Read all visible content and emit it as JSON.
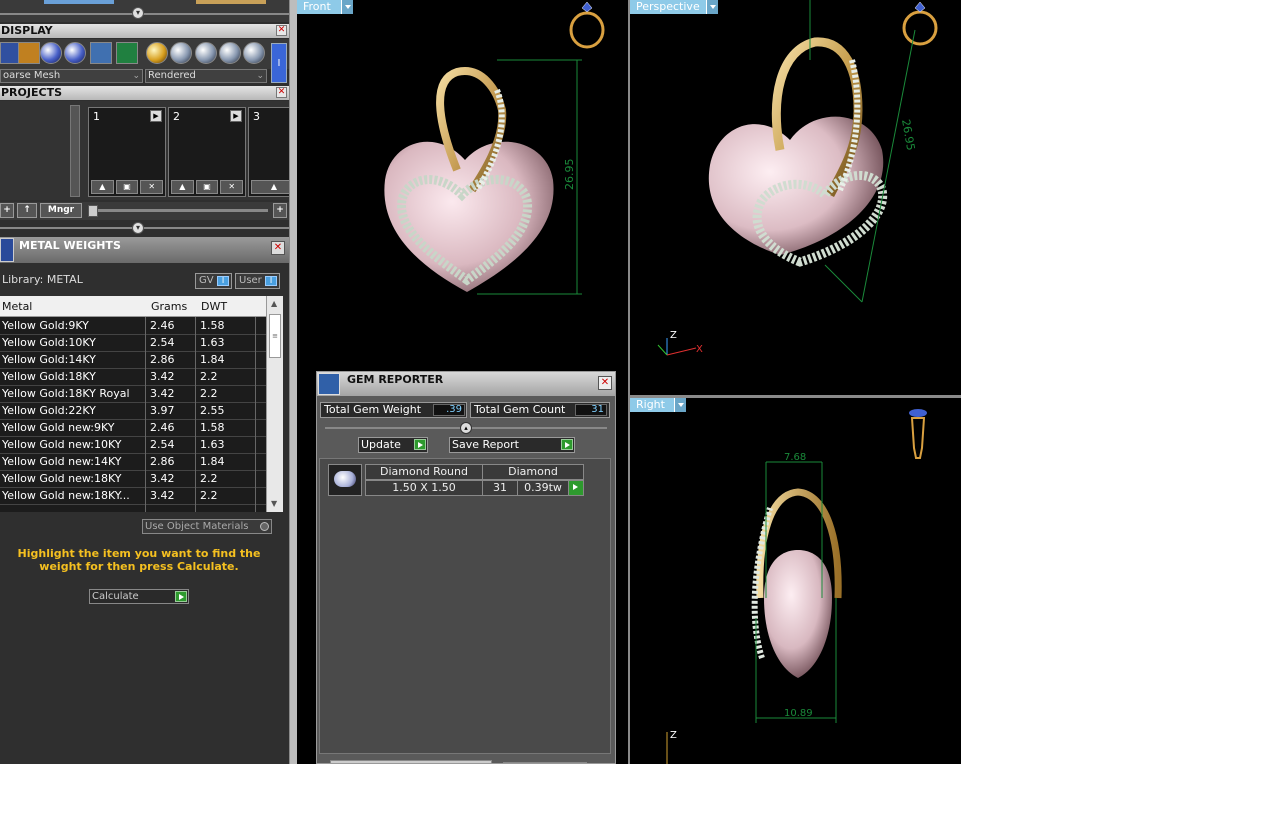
{
  "display_panel": {
    "title": "DISPLAY",
    "mesh_mode": "oarse Mesh",
    "render_mode": "Rendered",
    "mode_button": "I",
    "icons": [
      "grid-icon",
      "move-icon",
      "sphere-icon",
      "sphere-shaded-icon",
      "globe-icon",
      "layout-icon",
      "gold-material-icon",
      "metal-sphere-icon",
      "steel-sphere-icon",
      "wire-sphere-icon",
      "wire-sphere-2-icon"
    ]
  },
  "projects_panel": {
    "title": "PROJECTS",
    "slots": [
      {
        "number": "1"
      },
      {
        "number": "2"
      },
      {
        "number": "3"
      }
    ],
    "mngr_label": "Mngr",
    "add_label": "+",
    "up_label": "↑",
    "plus_right": "+"
  },
  "metal_weights": {
    "title": "METAL WEIGHTS",
    "library_label": "Library: METAL",
    "gv_label": "GV",
    "user_label": "User",
    "toggle_mark": "I",
    "columns": [
      "Metal",
      "Grams",
      "DWT"
    ],
    "rows": [
      {
        "metal": "Yellow Gold:9KY",
        "grams": "2.46",
        "dwt": "1.58"
      },
      {
        "metal": "Yellow Gold:10KY",
        "grams": "2.54",
        "dwt": "1.63"
      },
      {
        "metal": "Yellow Gold:14KY",
        "grams": "2.86",
        "dwt": "1.84"
      },
      {
        "metal": "Yellow Gold:18KY",
        "grams": "3.42",
        "dwt": "2.2"
      },
      {
        "metal": "Yellow Gold:18KY Royal",
        "grams": "3.42",
        "dwt": "2.2"
      },
      {
        "metal": "Yellow Gold:22KY",
        "grams": "3.97",
        "dwt": "2.55"
      },
      {
        "metal": "Yellow Gold new:9KY",
        "grams": "2.46",
        "dwt": "1.58"
      },
      {
        "metal": "Yellow Gold new:10KY",
        "grams": "2.54",
        "dwt": "1.63"
      },
      {
        "metal": "Yellow Gold new:14KY",
        "grams": "2.86",
        "dwt": "1.84"
      },
      {
        "metal": "Yellow Gold new:18KY",
        "grams": "3.42",
        "dwt": "2.2"
      },
      {
        "metal": "Yellow Gold new:18KY...",
        "grams": "3.42",
        "dwt": "2.2"
      }
    ],
    "use_object_materials": "Use Object Materials",
    "hint": "Highlight the item you want to find the weight for then press Calculate.",
    "calculate_label": "Calculate"
  },
  "viewports": {
    "front": {
      "label": "Front",
      "dimension": "26.95"
    },
    "perspective": {
      "label": "Perspective",
      "dimension": "26.95"
    },
    "right": {
      "label": "Right",
      "dim_top": "7.68",
      "dim_bottom": "10.89"
    },
    "axis": {
      "z": "Z",
      "x": "X"
    }
  },
  "gem_reporter": {
    "title": "GEM REPORTER",
    "total_weight_label": "Total Gem Weight",
    "total_weight_value": ".39",
    "total_count_label": "Total Gem Count",
    "total_count_value": "31",
    "update_label": "Update",
    "save_report_label": "Save Report",
    "gems": [
      {
        "shape": "Diamond Round",
        "material": "Diamond",
        "size": "1.50 X 1.50",
        "count": "31",
        "weight": "0.39tw"
      }
    ]
  },
  "colors": {
    "accent_green": "#2e9a2e",
    "hint_yellow": "#f5c020",
    "dimension_green": "#1a8a3a",
    "viewport_label": "#8ecae8"
  }
}
